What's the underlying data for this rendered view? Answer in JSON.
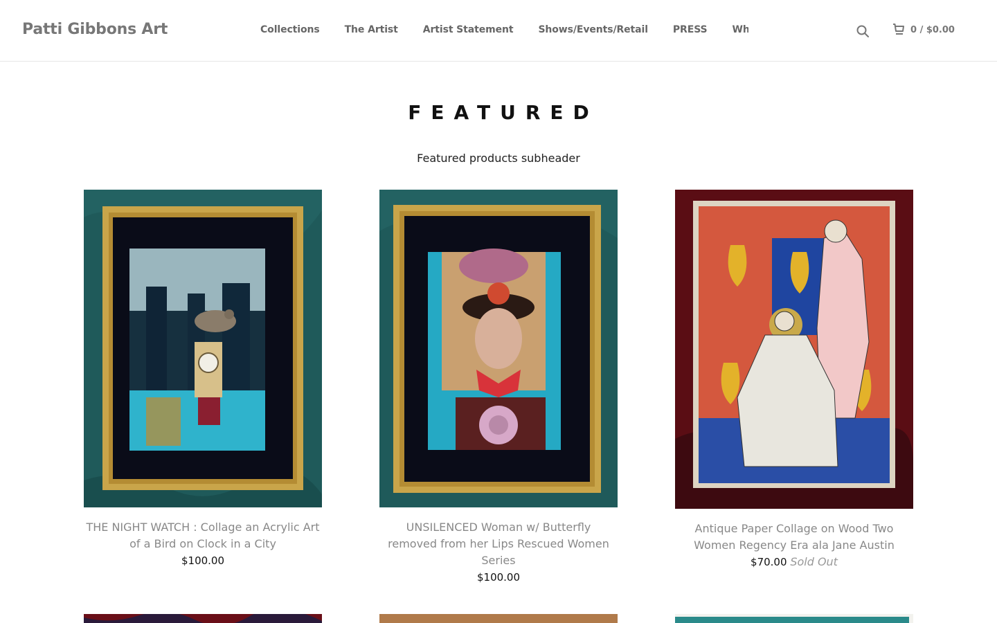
{
  "site": {
    "logo": "Patti Gibbons Art"
  },
  "nav": {
    "items": [
      "Collections",
      "The Artist",
      "Artist Statement",
      "Shows/Events/Retail",
      "PRESS",
      "What's New"
    ]
  },
  "cart": {
    "summary": "0 / $0.00"
  },
  "icons": {
    "search": "search-icon",
    "cart": "cart-icon"
  },
  "featured": {
    "title": "FEATURED",
    "subheader": "Featured products subheader"
  },
  "products": [
    {
      "title": "THE NIGHT WATCH : Collage an Acrylic Art of a Bird on Clock in a City",
      "price": "$100.00",
      "status": ""
    },
    {
      "title": "UNSILENCED Woman w/ Butterfly removed from her Lips Rescued Women Series",
      "price": "$100.00",
      "status": ""
    },
    {
      "title": "Antique Paper Collage on Wood Two Women Regency Era ala Jane Austin",
      "price": "$70.00",
      "status": "Sold Out"
    }
  ],
  "colors": {
    "accent_teal": "#1f5a5a",
    "frame_gold": "#c9a54a",
    "burgundy": "#5a0d14"
  }
}
